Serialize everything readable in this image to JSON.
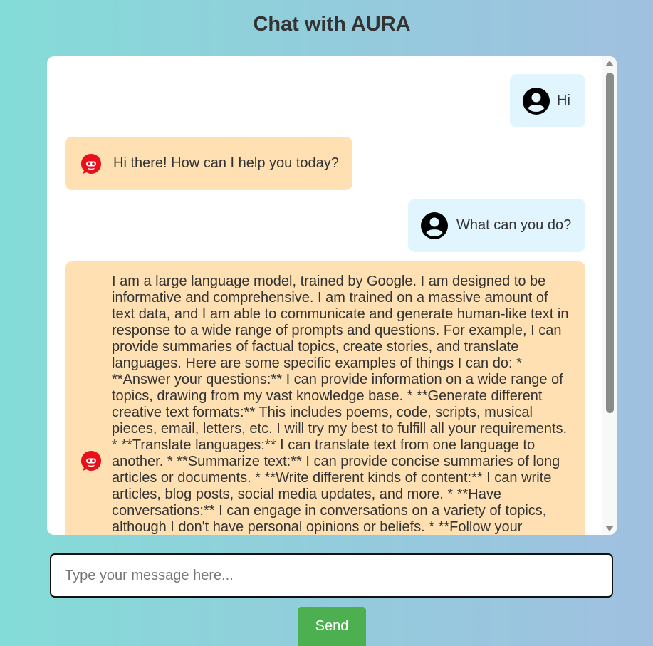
{
  "page": {
    "title": "Chat with AURA",
    "background_gradient": [
      "#84dcd8",
      "#a0c0e0"
    ]
  },
  "messages": [
    {
      "sender": "user",
      "avatar_icon": "user-account-icon",
      "text": "Hi"
    },
    {
      "sender": "bot",
      "avatar_icon": "aura-bot-icon",
      "text": "Hi there! How can I help you today?"
    },
    {
      "sender": "user",
      "avatar_icon": "user-account-icon",
      "text": "What can you do?"
    },
    {
      "sender": "bot",
      "avatar_icon": "aura-bot-icon",
      "text": "I am a large language model, trained by Google. I am designed to be informative and comprehensive. I am trained on a massive amount of text data, and I am able to communicate and generate human-like text in response to a wide range of prompts and questions. For example, I can provide summaries of factual topics, create stories, and translate languages. Here are some specific examples of things I can do: * **Answer your questions:** I can provide information on a wide range of topics, drawing from my vast knowledge base. * **Generate different creative text formats:** This includes poems, code, scripts, musical pieces, email, letters, etc. I will try my best to fulfill all your requirements. * **Translate languages:** I can translate text from one language to another. * **Summarize text:** I can provide concise summaries of long articles or documents. * **Write different kinds of content:** I can write articles, blog posts, social media updates, and more. * **Have conversations:** I can engage in conversations on a variety of topics, although I don't have personal opinions or beliefs. * **Follow your"
    }
  ],
  "input": {
    "placeholder": "Type your message here...",
    "value": ""
  },
  "send_button": {
    "label": "Send"
  },
  "colors": {
    "user_bubble": "#e1f5fe",
    "bot_bubble": "#ffe0b2",
    "send_button": "#4caf50",
    "bot_icon": "#e8101a"
  }
}
